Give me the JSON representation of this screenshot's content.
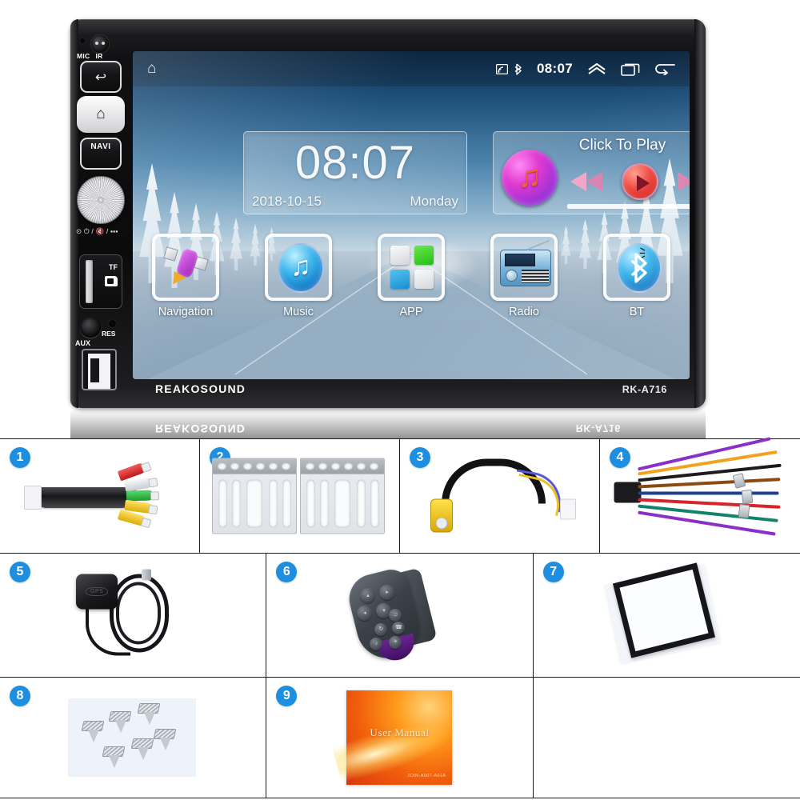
{
  "device": {
    "brand": "REAKOSOUND",
    "model": "RK-A716",
    "side_labels": {
      "mic": "MIC",
      "ir": "IR",
      "navi": "NAVI",
      "tf": "TF",
      "aux": "AUX",
      "res": "RES",
      "knob_icons": "⊙ ⏻ / 🔇 / ▪▪▪"
    },
    "buttons": [
      {
        "name": "back",
        "label": "↩"
      },
      {
        "name": "home",
        "label": "⌂"
      },
      {
        "name": "navi",
        "label": "NAVI"
      }
    ]
  },
  "screen": {
    "statusbar": {
      "home_glyph": "⌂",
      "cast_icon": "cast-icon",
      "bluetooth_icon": "bluetooth-icon",
      "clock": "08:07",
      "chevron_up_glyph": "ⱏ",
      "recents_glyph": "❐",
      "back_glyph": "↩"
    },
    "clock_widget": {
      "time": "08:07",
      "date": "2018-10-15",
      "weekday": "Monday"
    },
    "music_widget": {
      "cta": "Click To Play",
      "prev": "prev-track",
      "play": "play",
      "next": "next-track"
    },
    "apps": [
      {
        "label": "Navigation",
        "icon": "satellite-icon"
      },
      {
        "label": "Music",
        "icon": "music-note-icon"
      },
      {
        "label": "APP",
        "icon": "app-grid-icon"
      },
      {
        "label": "Radio",
        "icon": "radio-icon"
      },
      {
        "label": "BT",
        "icon": "bluetooth-icon"
      }
    ]
  },
  "accessories": {
    "rows": [
      [
        {
          "number": "1",
          "name": "rca-av-harness"
        },
        {
          "number": "2",
          "name": "metal-mounting-brackets"
        },
        {
          "number": "3",
          "name": "rear-camera-cable"
        },
        {
          "number": "4",
          "name": "iso-power-wiring-harness"
        }
      ],
      [
        {
          "number": "5",
          "name": "gps-antenna"
        },
        {
          "number": "6",
          "name": "steering-wheel-remote"
        },
        {
          "number": "7",
          "name": "plastic-trim-frame"
        }
      ],
      [
        {
          "number": "8",
          "name": "mounting-screws"
        },
        {
          "number": "9",
          "name": "user-manual",
          "title": "User Manual",
          "code": "2DIN-A007-A01A"
        },
        {
          "number": "",
          "name": "empty-cell"
        }
      ]
    ]
  },
  "colors": {
    "badge_blue": "#1e8fe0",
    "grid_line": "#1a1a1a",
    "bezel_black": "#111113",
    "accent_red": "#f0433a",
    "accent_green": "#22bd15",
    "accent_blue": "#168fd3"
  }
}
